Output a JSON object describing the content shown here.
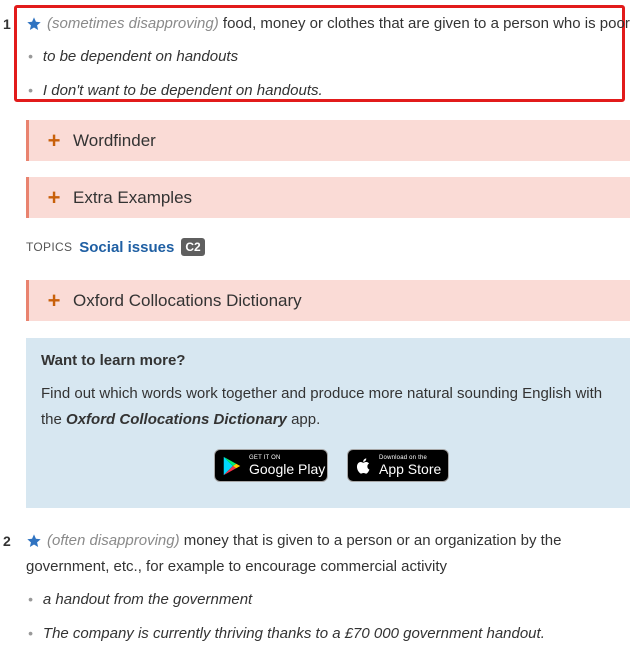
{
  "sense1": {
    "number": "1",
    "grammar": "(sometimes disapproving)",
    "definition": "food, money or clothes that are given to a person who is poor",
    "examples": [
      "to be dependent on handouts",
      "I don't want to be dependent on handouts."
    ]
  },
  "sections": {
    "wordfinder": "Wordfinder",
    "extra_examples": "Extra Examples",
    "collocations": "Oxford Collocations Dictionary"
  },
  "topics": {
    "label": "TOPICS",
    "topic": "Social issues",
    "level": "C2"
  },
  "promo": {
    "title": "Want to learn more?",
    "text_before": "Find out which words work together and produce more natural sounding English with the ",
    "brand": "Oxford Collocations Dictionary",
    "text_after": " app.",
    "google_small": "GET IT ON",
    "google_big": "Google Play",
    "apple_small": "Download on the",
    "apple_big": "App Store"
  },
  "sense2": {
    "number": "2",
    "grammar": "(often disapproving)",
    "definition": "money that is given to a person or an organization by the government, etc., for example to encourage commercial activity",
    "examples": [
      "a handout from the government",
      "The company is currently thriving thanks to a £70 000 government handout."
    ]
  },
  "colors": {
    "highlight": "#e21b1b",
    "collapsible_bg": "#fadbd6",
    "collapsible_accent": "#c8600a",
    "promo_bg": "#d7e7f1",
    "link": "#1f5fa3",
    "star": "#2f73c1"
  },
  "icons": [
    "star-icon",
    "plus-icon",
    "google-play-icon",
    "apple-icon"
  ]
}
